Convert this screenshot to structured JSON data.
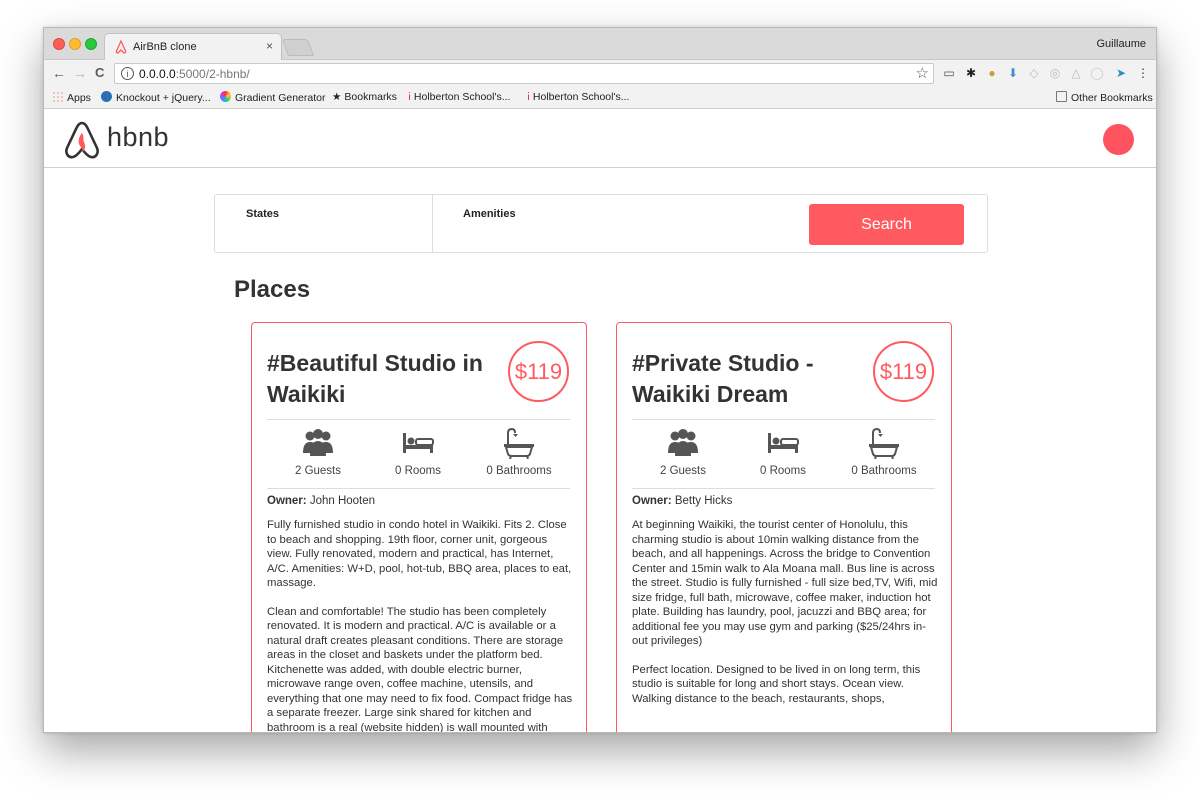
{
  "browser": {
    "tab_title": "AirBnB clone",
    "tab_close": "×",
    "profile_name": "Guillaume",
    "url_host": "0.0.0.0",
    "url_path": ":5000/2-hbnb/",
    "back_icon": "←",
    "forward_icon": "→",
    "reload_icon": "C",
    "star_icon": "☆",
    "menu_icon": "⋮"
  },
  "bookmarks": {
    "items": [
      "Apps",
      "Knockout + jQuery...",
      "Gradient Generator",
      "Bookmarks",
      "Holberton School's...",
      "Holberton School's..."
    ],
    "other": "Other Bookmarks"
  },
  "header": {
    "logo_text": "hbnb",
    "brand_color": "#ff5a5f"
  },
  "filters": {
    "states_label": "States",
    "amenities_label": "Amenities",
    "search_label": "Search"
  },
  "places": {
    "title": "Places",
    "items": [
      {
        "name": "#Beautiful Studio in Waikiki",
        "price": "$119",
        "guests": "2 Guests",
        "rooms": "0 Rooms",
        "bathrooms": "0 Bathrooms",
        "owner_label": "Owner:",
        "owner": "John Hooten",
        "description": [
          "Fully furnished studio in condo hotel in Waikiki. Fits 2. Close to beach and shopping. 19th floor, corner unit, gorgeous view. Fully renovated, modern and practical, has Internet, A/C. Amenities: W+D, pool, hot-tub, BBQ area, places to eat, massage.",
          "Clean and comfortable! The studio has been completely renovated. It is modern and practical. A/C is available or a natural draft creates pleasant conditions. There are storage areas in the closet and baskets under the platform bed. Kitchenette was added, with double electric burner, microwave range oven, coffee machine, utensils, and everything that one may need to fix food. Compact fridge has a separate freezer. Large sink shared for kitchen and bathroom is a real (website hidden) is wall mounted with"
        ]
      },
      {
        "name": "#Private Studio - Waikiki Dream",
        "price": "$119",
        "guests": "2 Guests",
        "rooms": "0 Rooms",
        "bathrooms": "0 Bathrooms",
        "owner_label": "Owner:",
        "owner": "Betty Hicks",
        "description": [
          "At beginning Waikiki, the tourist center of Honolulu, this charming studio is about 10min walking distance from the beach, and all happenings. Across the bridge to Convention Center and 15min walk to Ala Moana mall. Bus line is across the street. Studio is fully furnished - full size bed,TV, Wifi, mid size fridge, full bath, microwave, coffee maker, induction hot plate. Building has laundry, pool, jacuzzi and BBQ area; for additional fee you may use gym and parking ($25/24hrs in-out privileges)",
          "Perfect location. Designed to be lived in on long term, this studio is suitable for long and short stays. Ocean view. Walking distance to the beach, restaurants, shops,"
        ]
      }
    ]
  }
}
